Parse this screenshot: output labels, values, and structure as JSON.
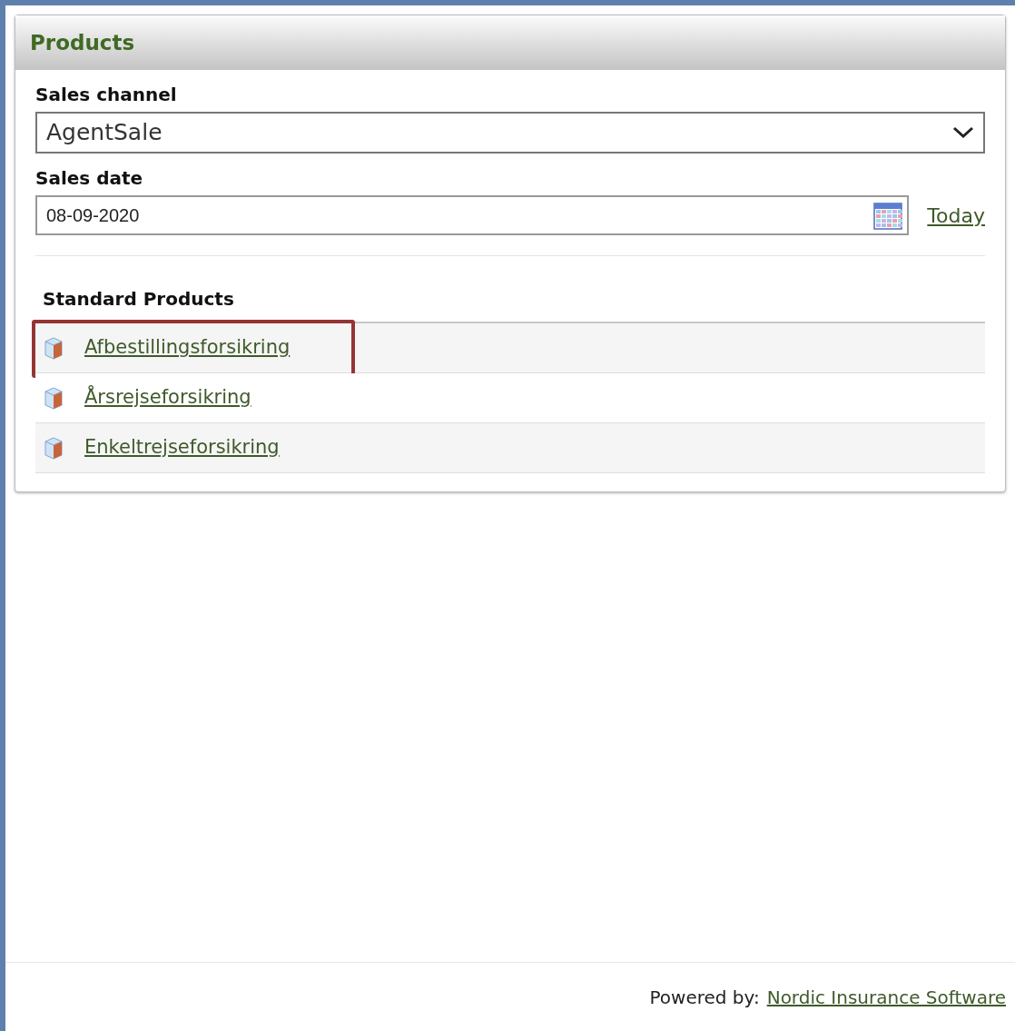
{
  "panel": {
    "title": "Products"
  },
  "sales_channel": {
    "label": "Sales channel",
    "value": "AgentSale"
  },
  "sales_date": {
    "label": "Sales date",
    "value": "08-09-2020",
    "today_link": "Today"
  },
  "standard_products": {
    "heading": "Standard Products",
    "items": [
      {
        "label": "Afbestillingsforsikring",
        "highlighted": true
      },
      {
        "label": "Årsrejseforsikring",
        "highlighted": false
      },
      {
        "label": "Enkeltrejseforsikring",
        "highlighted": false
      }
    ]
  },
  "footer": {
    "prefix": "Powered by:",
    "link": "Nordic Insurance Software"
  }
}
